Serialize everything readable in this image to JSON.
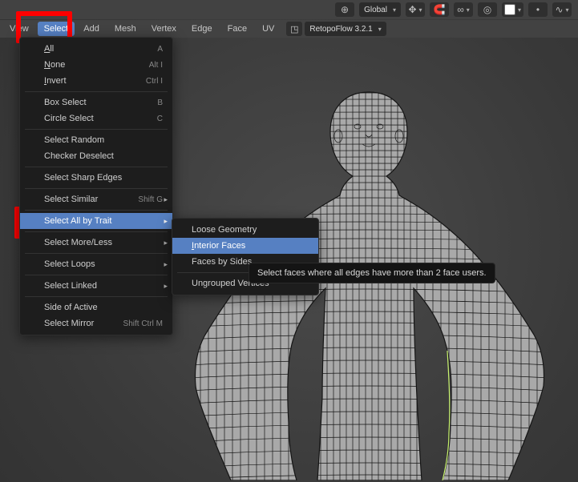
{
  "header": {
    "orientation_label": "Global",
    "snap_icon": "🧲",
    "link_icon": "∞",
    "dot_icon": "•",
    "color_icon": "■",
    "curve_icon": "∿"
  },
  "toolbar": {
    "view": "View",
    "select": "Select",
    "add": "Add",
    "mesh": "Mesh",
    "vertex": "Vertex",
    "edge": "Edge",
    "face": "Face",
    "uv": "UV",
    "retopo_icon": "◳",
    "retopo_label": "RetopoFlow 3.2.1"
  },
  "menu": {
    "all": "All",
    "all_sc": "A",
    "none": "None",
    "none_sc": "Alt I",
    "invert": "Invert",
    "invert_sc": "Ctrl I",
    "box": "Box Select",
    "box_sc": "B",
    "circle": "Circle Select",
    "circle_sc": "C",
    "random": "Select Random",
    "checker": "Checker Deselect",
    "sharp": "Select Sharp Edges",
    "similar": "Select Similar",
    "similar_sc": "Shift G",
    "trait": "Select All by Trait",
    "moreless": "Select More/Less",
    "loops": "Select Loops",
    "linked": "Select Linked",
    "side": "Side of Active",
    "mirror": "Select Mirror",
    "mirror_sc": "Shift Ctrl M"
  },
  "submenu": {
    "loose": "Loose Geometry",
    "interior": "Interior Faces",
    "bysides": "Faces by Sides",
    "ungrouped": "Ungrouped Vertices"
  },
  "tooltip": "Select faces where all edges have more than 2 face users."
}
